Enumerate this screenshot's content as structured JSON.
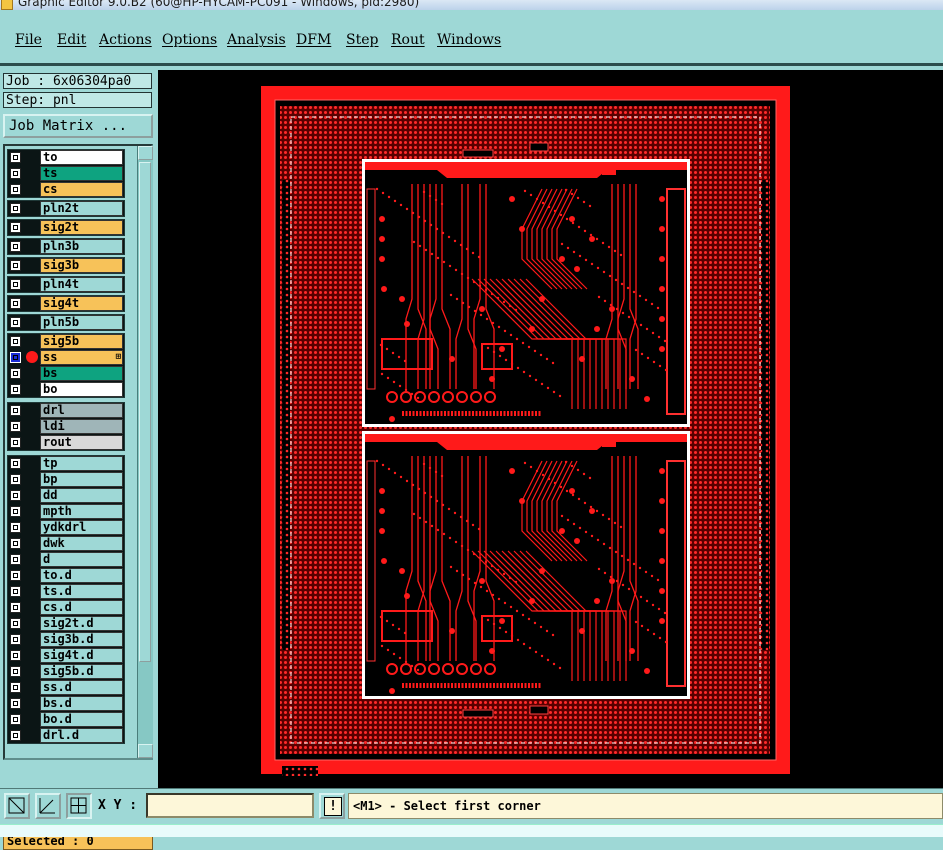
{
  "window": {
    "title": "Graphic Editor 9.0.B2 (60@HP-HYCAM-PC091 - Windows, pid:2980)"
  },
  "menu": [
    "File",
    "Edit",
    "Actions",
    "Options",
    "Analysis",
    "DFM",
    "Step",
    "Rout",
    "Windows"
  ],
  "job": {
    "label": "Job : 6x06304pa0",
    "step": "Step: pnl",
    "matrix_button": "Job Matrix ..."
  },
  "layers": [
    {
      "name": "to",
      "color": "#ffffff",
      "selected": false
    },
    {
      "name": "ts",
      "color": "#0ea380",
      "selected": false
    },
    {
      "name": "cs",
      "color": "#f7c259",
      "selected": false
    },
    {
      "name": "pln2t",
      "color": "#9ed8d6",
      "selected": false
    },
    {
      "name": "sig2t",
      "color": "#f7c259",
      "selected": false
    },
    {
      "name": "pln3b",
      "color": "#9ed8d6",
      "selected": false
    },
    {
      "name": "sig3b",
      "color": "#f7c259",
      "selected": false
    },
    {
      "name": "pln4t",
      "color": "#9ed8d6",
      "selected": false
    },
    {
      "name": "sig4t",
      "color": "#f7c259",
      "selected": false
    },
    {
      "name": "pln5b",
      "color": "#9ed8d6",
      "selected": false
    },
    {
      "name": "sig5b",
      "color": "#f7c259",
      "selected": false
    },
    {
      "name": "ss",
      "color": "#f7c259",
      "selected": true,
      "marker": "⊞"
    },
    {
      "name": "bs",
      "color": "#0ea380",
      "selected": false
    },
    {
      "name": "bo",
      "color": "#ffffff",
      "selected": false
    },
    {
      "name": "drl",
      "color": "#9fb5b8",
      "selected": false
    },
    {
      "name": "ldi",
      "color": "#9fb5b8",
      "selected": false
    },
    {
      "name": "rout",
      "color": "#d9d9d9",
      "selected": false
    },
    {
      "name": "tp",
      "color": "#9ed8d6",
      "selected": false
    },
    {
      "name": "bp",
      "color": "#9ed8d6",
      "selected": false
    },
    {
      "name": "dd",
      "color": "#9ed8d6",
      "selected": false
    },
    {
      "name": "mpth",
      "color": "#9ed8d6",
      "selected": false
    },
    {
      "name": "ydkdrl",
      "color": "#9ed8d6",
      "selected": false
    },
    {
      "name": "dwk",
      "color": "#9ed8d6",
      "selected": false
    },
    {
      "name": "d",
      "color": "#9ed8d6",
      "selected": false
    },
    {
      "name": "to.d",
      "color": "#9ed8d6",
      "selected": false
    },
    {
      "name": "ts.d",
      "color": "#9ed8d6",
      "selected": false
    },
    {
      "name": "cs.d",
      "color": "#9ed8d6",
      "selected": false
    },
    {
      "name": "sig2t.d",
      "color": "#9ed8d6",
      "selected": false
    },
    {
      "name": "sig3b.d",
      "color": "#9ed8d6",
      "selected": false
    },
    {
      "name": "sig4t.d",
      "color": "#9ed8d6",
      "selected": false
    },
    {
      "name": "sig5b.d",
      "color": "#9ed8d6",
      "selected": false
    },
    {
      "name": "ss.d",
      "color": "#9ed8d6",
      "selected": false
    },
    {
      "name": "bs.d",
      "color": "#9ed8d6",
      "selected": false
    },
    {
      "name": "bo.d",
      "color": "#9ed8d6",
      "selected": false
    },
    {
      "name": "drl.d",
      "color": "#9ed8d6",
      "selected": false
    }
  ],
  "selected_count": "Selected : 0",
  "toolbar": {
    "xy_label": "X Y :",
    "xy_value": "",
    "warn_label": "!",
    "status": "<M1> - Select first corner"
  },
  "colors": {
    "panel": "#9ed8d6",
    "copper": "#ff1a1a",
    "canvas": "#000000"
  }
}
